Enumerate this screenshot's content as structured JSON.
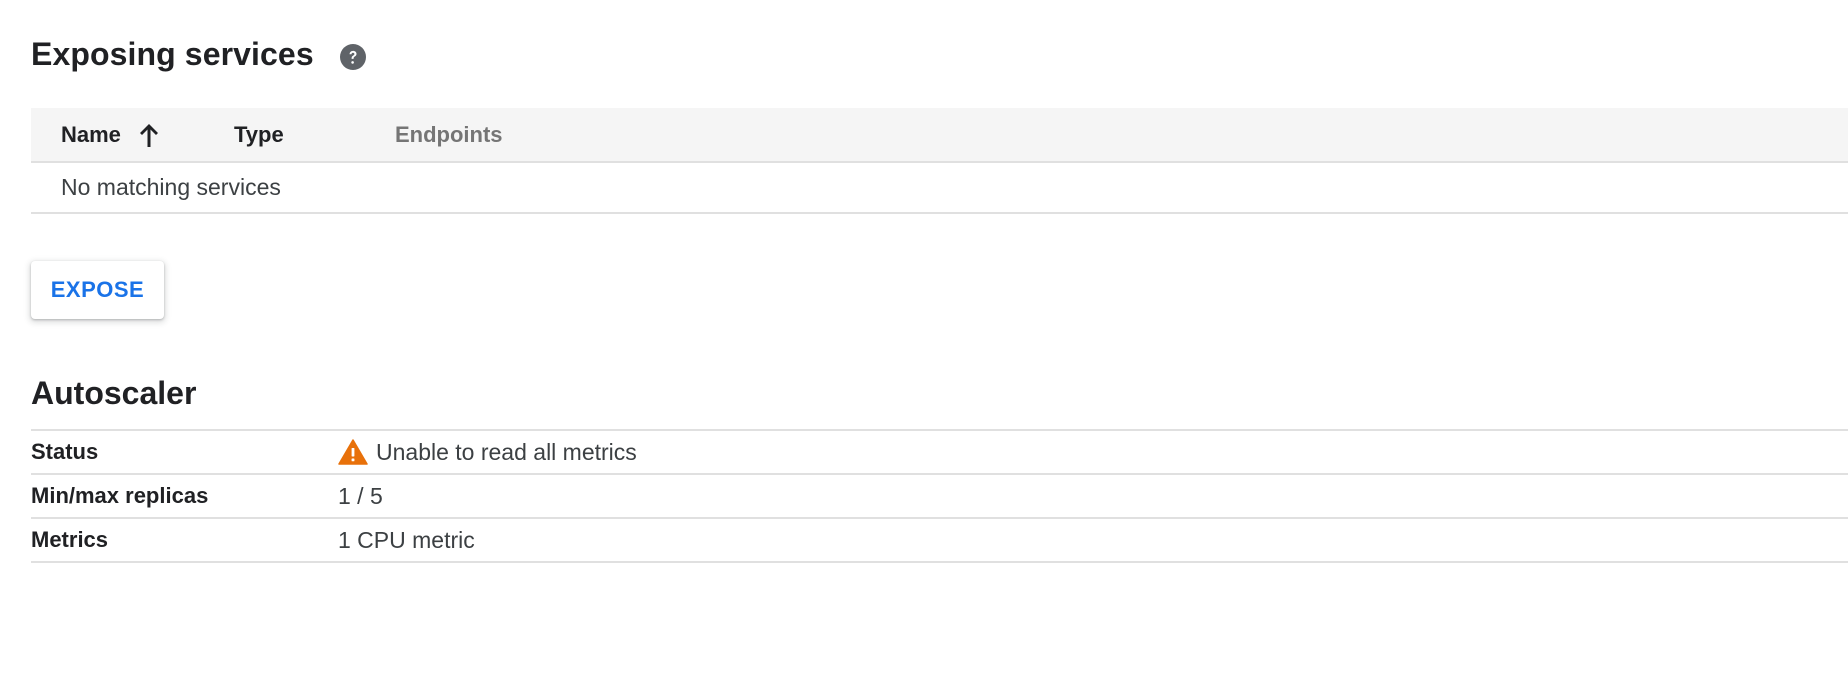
{
  "exposing_services": {
    "title": "Exposing services",
    "help_icon": "help-circle-icon",
    "table": {
      "columns": [
        "Name",
        "Type",
        "Endpoints"
      ],
      "sort_column": "Name",
      "sort_direction": "ascending",
      "sort_icon": "arrow-up-icon",
      "empty_message": "No matching services"
    },
    "expose_button": "EXPOSE"
  },
  "autoscaler": {
    "title": "Autoscaler",
    "rows": [
      {
        "key": "Status",
        "value": "Unable to read all metrics",
        "icon": "warning-icon"
      },
      {
        "key": "Min/max replicas",
        "value": "1 / 5"
      },
      {
        "key": "Metrics",
        "value": "1 CPU metric"
      }
    ]
  },
  "colors": {
    "accent": "#1a73e8",
    "warning": "#e8710a",
    "header_bg": "#f5f5f5",
    "divider": "#e0e0e0"
  }
}
